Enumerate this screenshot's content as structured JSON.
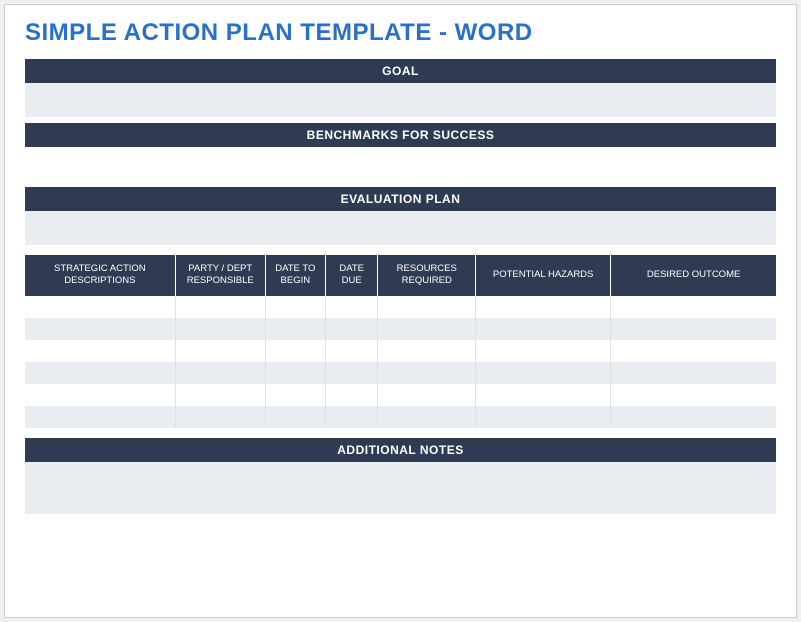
{
  "title": "SIMPLE ACTION PLAN TEMPLATE - WORD",
  "sections": {
    "goal": {
      "label": "GOAL",
      "value": ""
    },
    "benchmarks": {
      "label": "BENCHMARKS FOR SUCCESS",
      "value": ""
    },
    "evaluation": {
      "label": "EVALUATION PLAN",
      "value": ""
    },
    "notes": {
      "label": "ADDITIONAL NOTES",
      "value": ""
    }
  },
  "table": {
    "headers": [
      "STRATEGIC ACTION DESCRIPTIONS",
      "PARTY / DEPT RESPONSIBLE",
      "DATE TO BEGIN",
      "DATE DUE",
      "RESOURCES REQUIRED",
      "POTENTIAL HAZARDS",
      "DESIRED OUTCOME"
    ],
    "rows": [
      {
        "c0": "",
        "c1": "",
        "c2": "",
        "c3": "",
        "c4": "",
        "c5": "",
        "c6": ""
      },
      {
        "c0": "",
        "c1": "",
        "c2": "",
        "c3": "",
        "c4": "",
        "c5": "",
        "c6": ""
      },
      {
        "c0": "",
        "c1": "",
        "c2": "",
        "c3": "",
        "c4": "",
        "c5": "",
        "c6": ""
      },
      {
        "c0": "",
        "c1": "",
        "c2": "",
        "c3": "",
        "c4": "",
        "c5": "",
        "c6": ""
      },
      {
        "c0": "",
        "c1": "",
        "c2": "",
        "c3": "",
        "c4": "",
        "c5": "",
        "c6": ""
      },
      {
        "c0": "",
        "c1": "",
        "c2": "",
        "c3": "",
        "c4": "",
        "c5": "",
        "c6": ""
      }
    ]
  }
}
